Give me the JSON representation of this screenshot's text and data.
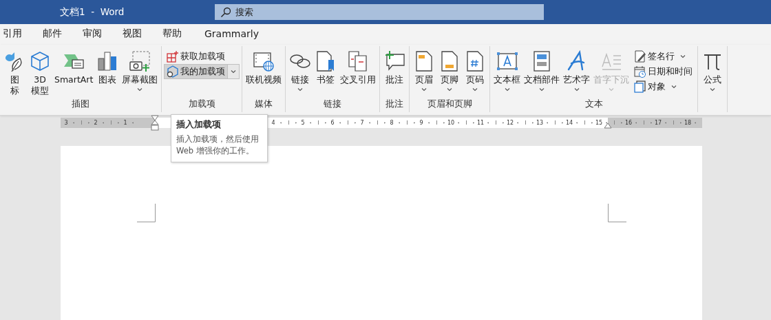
{
  "window": {
    "title": "文档1  -  Word"
  },
  "search": {
    "placeholder": "搜索"
  },
  "tabs": [
    {
      "label": "引用",
      "selected": false
    },
    {
      "label": "邮件",
      "selected": false
    },
    {
      "label": "审阅",
      "selected": false
    },
    {
      "label": "视图",
      "selected": false
    },
    {
      "label": "帮助",
      "selected": false
    },
    {
      "label": "Grammarly",
      "selected": false
    }
  ],
  "ribbon": {
    "groups": [
      {
        "label": "插图",
        "items": [
          {
            "kind": "large",
            "lines": [
              "图",
              "标"
            ],
            "dropdown": false,
            "disabled": false
          },
          {
            "kind": "large",
            "lines": [
              "3D",
              "模型"
            ],
            "dropdown": false,
            "disabled": false
          },
          {
            "kind": "large",
            "label": "SmartArt",
            "dropdown": false,
            "disabled": false
          },
          {
            "kind": "large",
            "label": "图表",
            "dropdown": false,
            "disabled": false
          },
          {
            "kind": "large",
            "label": "屏幕截图",
            "dropdown": true,
            "disabled": false
          }
        ]
      },
      {
        "label": "加载项",
        "items": [
          {
            "kind": "stack",
            "items": [
              {
                "label": "获取加载项",
                "dropdown": false,
                "highlighted": false
              },
              {
                "label": "我的加载项",
                "dropdown": true,
                "highlighted": true
              }
            ]
          }
        ]
      },
      {
        "label": "媒体",
        "items": [
          {
            "kind": "large",
            "label": "联机视频",
            "dropdown": false,
            "disabled": false
          }
        ]
      },
      {
        "label": "链接",
        "items": [
          {
            "kind": "large",
            "label": "链接",
            "dropdown": true,
            "disabled": false
          },
          {
            "kind": "large",
            "label": "书签",
            "dropdown": false,
            "disabled": false
          },
          {
            "kind": "large",
            "label": "交叉引用",
            "dropdown": false,
            "disabled": false
          }
        ]
      },
      {
        "label": "批注",
        "items": [
          {
            "kind": "large",
            "label": "批注",
            "dropdown": false,
            "disabled": false
          }
        ]
      },
      {
        "label": "页眉和页脚",
        "items": [
          {
            "kind": "large",
            "label": "页眉",
            "dropdown": true,
            "disabled": false
          },
          {
            "kind": "large",
            "label": "页脚",
            "dropdown": true,
            "disabled": false
          },
          {
            "kind": "large",
            "label": "页码",
            "dropdown": true,
            "disabled": false
          }
        ]
      },
      {
        "label": "文本",
        "items": [
          {
            "kind": "large",
            "label": "文本框",
            "dropdown": true,
            "disabled": false
          },
          {
            "kind": "large",
            "label": "文档部件",
            "dropdown": true,
            "disabled": false
          },
          {
            "kind": "large",
            "label": "艺术字",
            "dropdown": true,
            "disabled": false
          },
          {
            "kind": "large",
            "label": "首字下沉",
            "dropdown": true,
            "disabled": true
          },
          {
            "kind": "stack",
            "items": [
              {
                "label": "签名行",
                "dropdown": true,
                "highlighted": false
              },
              {
                "label": "日期和时间",
                "dropdown": false,
                "highlighted": false
              },
              {
                "label": "对象",
                "dropdown": true,
                "highlighted": false
              }
            ]
          }
        ]
      },
      {
        "items": [
          {
            "kind": "large",
            "label": "公式",
            "dropdown": true,
            "disabled": false
          }
        ]
      }
    ]
  },
  "ruler": {
    "left_numbers": [
      "3",
      "2",
      "1"
    ],
    "body_numbers": [
      "4",
      "5",
      "6",
      "7",
      "8",
      "9",
      "10",
      "11",
      "12",
      "13",
      "14",
      "15"
    ],
    "right_numbers": [
      "16",
      "17",
      "18"
    ]
  },
  "tooltip": {
    "title": "插入加载项",
    "text": "插入加载项，然后使用 Web 增强你的工作。"
  }
}
